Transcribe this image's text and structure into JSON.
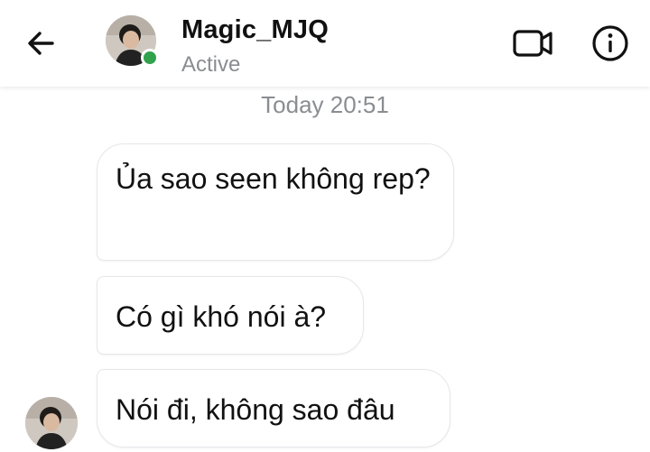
{
  "header": {
    "contact_name": "Magic_MJQ",
    "status": "Active",
    "online_color": "#31a24c",
    "back_icon": "arrow-left-icon",
    "video_icon": "video-camera-icon",
    "info_icon": "info-icon"
  },
  "chat": {
    "timestamp": "Today 20:51",
    "messages": [
      {
        "text": "Ủa sao seen không rep?"
      },
      {
        "text": "Có gì khó nói à?"
      },
      {
        "text": "Nói đi, không sao đâu"
      }
    ]
  }
}
